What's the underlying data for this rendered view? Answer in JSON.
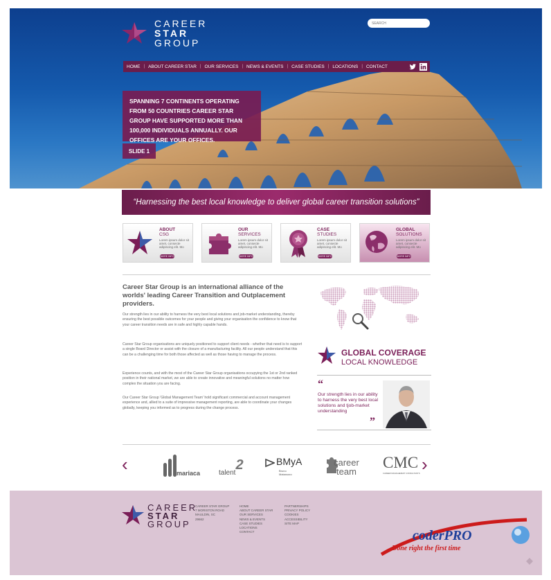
{
  "header": {
    "logo_lines": [
      "CAREER",
      "STAR",
      "GROUP"
    ],
    "search_placeholder": "SEARCH"
  },
  "nav": {
    "items": [
      "HOME",
      "ABOUT CAREER STAR",
      "OUR SERVICES",
      "NEWS & EVENTS",
      "CASE STUDIES",
      "LOCATIONS",
      "CONTACT"
    ],
    "social": [
      "twitter-icon",
      "linkedin-icon"
    ]
  },
  "hero": {
    "message": "SPANNING 7 CONTINENTS OPERATING FROM 50 COUNTRIES CAREER STAR GROUP HAVE SUPPORTED MORE THAN 100,000 INDIVIDUALS ANNUALLY. OUR OFFICES ARE YOUR OFFICES.",
    "slide_label": "SLIDE 1"
  },
  "tagline": "“Harnessing the best local knowledge to deliver global career transition solutions”",
  "cards": [
    {
      "title": "ABOUT",
      "sub": "CSG",
      "text": "Lorem ipsum dolor sit amet, consecte adipiscing elit. Mo",
      "button": "MORE INFO"
    },
    {
      "title": "OUR",
      "sub": "SERVICES",
      "text": "Lorem ipsum dolor sit amet, consecte adipiscing elit. Mo",
      "button": "MORE INFO"
    },
    {
      "title": "CASE",
      "sub": "STUDIES",
      "text": "Lorem ipsum dolor sit amet, consecte adipiscing elit. Mo",
      "button": "MORE INFO"
    },
    {
      "title": "GLOBAL",
      "sub": "SOLUTIONS",
      "text": "Lorem ipsum dolor sit amet, consecte adipiscing elit. Mo",
      "button": "MORE INFO"
    }
  ],
  "intro": {
    "title": "Career Star Group is an international alliance of the worlds' leading Career Transition and Outplacement providers.",
    "paragraphs": [
      "Our strength lies in our ability to harness the very best local solutions and job-market understanding, thereby ensuring the best possible outcomes for your people and giving your organisation the confidence to know that your career transition needs are in safe and highly capable hands.",
      "Career Star Group organisations are uniquely positioned to support client needs - whether that need is to support a single Board Director or assist with the closure of a manufacturing facility. All our people understand that this can be a challenging time for both those affected as well as those having to manage the process.",
      "Experience counts, and with the most of the Career Star Group organisations occupying the 1st or 2nd ranked position in their national market, we are able to create innovative and meaningful solutions no matter how complex the situation you are facing.",
      "Our Career Star Group 'Global Management Team' hold significant commercial and account management experience and, allied to a suite of impressive management reporting, are able to coordinate your changes globally, keeping you informed as to progress during the change process."
    ]
  },
  "coverage": {
    "line1": "GLOBAL COVERAGE",
    "line2": "LOCAL KNOWLEDGE"
  },
  "quote": {
    "open": "“",
    "text": "Our strength lies in our ability to harness the very best local solutions and tjob-market understanding",
    "close": "”"
  },
  "partners": {
    "prev": "‹",
    "next": "›",
    "mariaca": "mariaca",
    "talent2": "talent",
    "talent2_num": "2",
    "bmya": "BMyA",
    "bmya_sub": "Bruno Matarazzo",
    "career_team_1": "career",
    "career_team_2": "team",
    "cmc": "CMC",
    "cmc_sub": "CAREER MANAGEMENT CONSULTANTS"
  },
  "footer": {
    "logo_lines": [
      "CAREER",
      "STAR",
      "GROUP"
    ],
    "address": [
      "CAREER STAR GROUP",
      "7 MORISTON ROAD",
      "MAULDIN, SC",
      "29662"
    ],
    "links1": [
      "HOME",
      "ABOUT CAREER STAR",
      "OUR SERVICES",
      "NEWS & EVENTS",
      "CASE STUDIES",
      "LOCATIONS",
      "CONTACT"
    ],
    "links2": [
      "PARTNERSHIPS",
      "PRIVACY POLICY",
      "COOKIES",
      "ACCESSIBILITY",
      "SITE MAP"
    ]
  },
  "watermark": {
    "brand": "coderPRO",
    "slogan": "Done right the first time"
  },
  "colors": {
    "brand_purple": "#7a1d57",
    "nav_bg": "#6b1d4a",
    "footer_bg": "#dbc5d4",
    "sky": "#155aad"
  }
}
